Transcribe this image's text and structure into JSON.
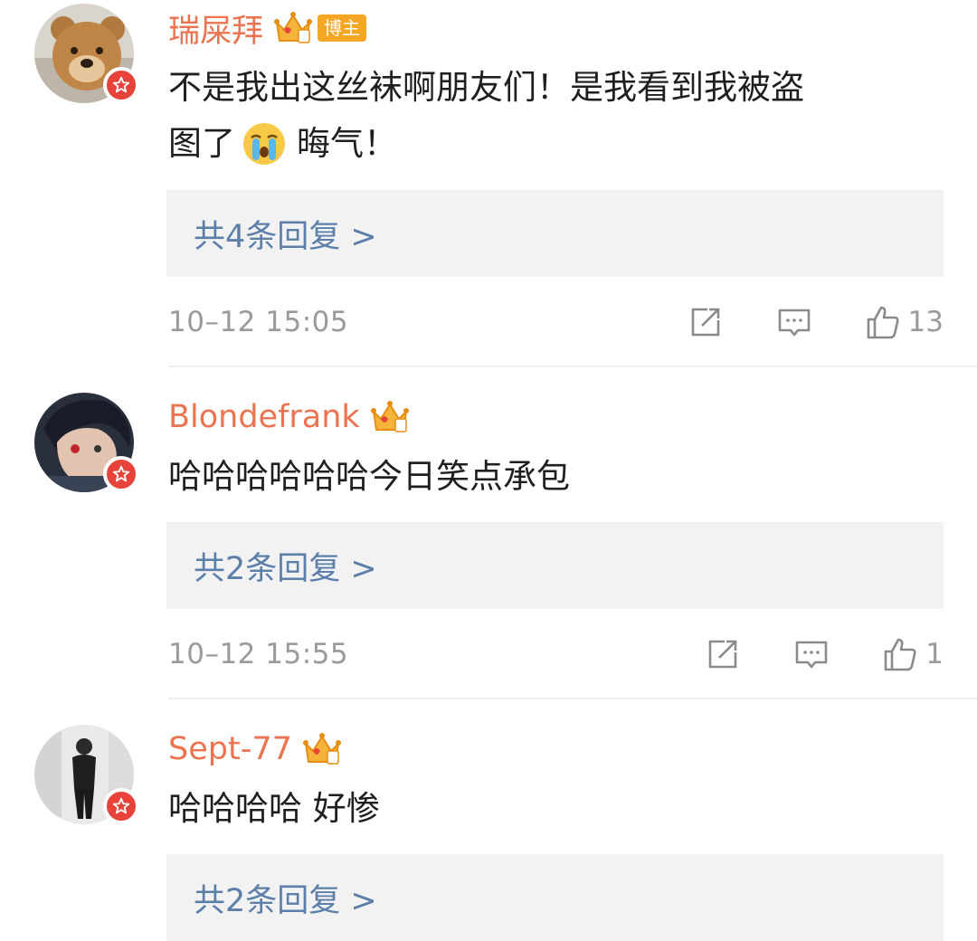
{
  "comments": [
    {
      "username": "瑞屎拜",
      "badge": "博主",
      "text_line1": "不是我出这丝袜啊朋友们！是我看到我被盗",
      "text_line2a": "图了",
      "text_line2b": "晦气！",
      "emoji": "crying-emoji",
      "replies": "共4条回复 >",
      "time": "10–12 15:05",
      "likes": "13"
    },
    {
      "username": "Blondefrank",
      "text": "哈哈哈哈哈哈今日笑点承包",
      "replies": "共2条回复 >",
      "time": "10–12 15:55",
      "likes": "1"
    },
    {
      "username": "Sept-77",
      "text": "哈哈哈哈 好惨",
      "replies": "共2条回复 >"
    }
  ],
  "colors": {
    "username": "#eb7350",
    "reply_link": "#5b7fa9",
    "meta": "#9a9a9a",
    "verified_badge": "#e8433a",
    "reply_bg": "#f2f2f2"
  },
  "icons": [
    "crown-icon",
    "verified-badge-icon",
    "repost-icon",
    "comment-icon",
    "like-icon"
  ]
}
